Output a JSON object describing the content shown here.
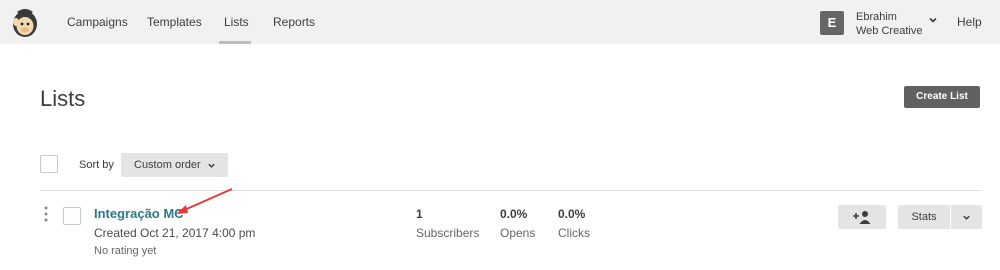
{
  "nav": {
    "items": [
      {
        "label": "Campaigns"
      },
      {
        "label": "Templates"
      },
      {
        "label": "Lists"
      },
      {
        "label": "Reports"
      }
    ],
    "active": "Lists",
    "logo_icon": "mailchimp-logo-icon"
  },
  "account": {
    "initial": "E",
    "name": "Ebrahim",
    "organization": "Web Creative",
    "menu_icon": "chevron-down-icon"
  },
  "help_label": "Help",
  "page": {
    "title": "Lists",
    "create_label": "Create List"
  },
  "toolbar": {
    "sort_label": "Sort by",
    "sort_value": "Custom order"
  },
  "lists": [
    {
      "name": "Integração MC",
      "created": "Created Oct 21, 2017 4:00 pm",
      "rating": "No rating yet",
      "subscribers": {
        "value": "1",
        "label": "Subscribers"
      },
      "opens": {
        "value": "0.0%",
        "label": "Opens"
      },
      "clicks": {
        "value": "0.0%",
        "label": "Clicks"
      },
      "stats_label": "Stats"
    }
  ],
  "colors": {
    "nav_bg": "#f1f1f1",
    "link": "#2b7a8a",
    "primary_button": "#616161",
    "secondary_button": "#e4e4e4",
    "annotation_arrow": "#e53935"
  }
}
